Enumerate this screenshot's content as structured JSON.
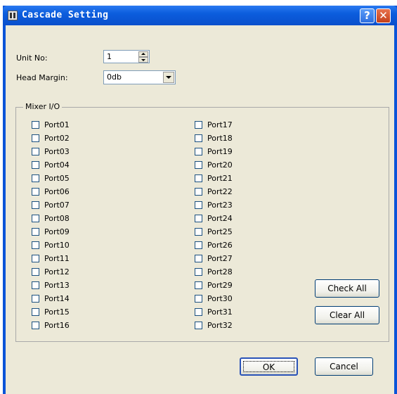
{
  "window": {
    "title": "Cascade Setting"
  },
  "titlebar_buttons": {
    "help": "?",
    "close": "✕"
  },
  "unit_no": {
    "label": "Unit No:",
    "value": "1"
  },
  "head_margin": {
    "label": "Head Margin:",
    "value": "0db"
  },
  "mixer_io": {
    "title": "Mixer I/O",
    "ports": [
      "Port01",
      "Port02",
      "Port03",
      "Port04",
      "Port05",
      "Port06",
      "Port07",
      "Port08",
      "Port09",
      "Port10",
      "Port11",
      "Port12",
      "Port13",
      "Port14",
      "Port15",
      "Port16",
      "Port17",
      "Port18",
      "Port19",
      "Port20",
      "Port21",
      "Port22",
      "Port23",
      "Port24",
      "Port25",
      "Port26",
      "Port27",
      "Port28",
      "Port29",
      "Port30",
      "Port31",
      "Port32"
    ],
    "checked": [
      false,
      false,
      false,
      false,
      false,
      false,
      false,
      false,
      false,
      false,
      false,
      false,
      false,
      false,
      false,
      false,
      false,
      false,
      false,
      false,
      false,
      false,
      false,
      false,
      false,
      false,
      false,
      false,
      false,
      false,
      false,
      false
    ]
  },
  "buttons": {
    "check_all": "Check All",
    "clear_all": "Clear All",
    "ok": "OK",
    "cancel": "Cancel"
  }
}
